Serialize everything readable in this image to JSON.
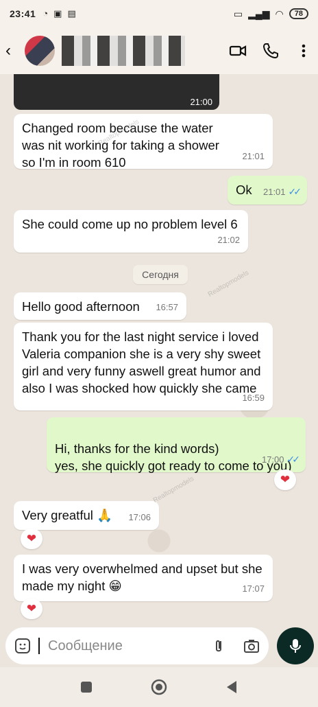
{
  "status_bar": {
    "time": "23:41",
    "battery": "78"
  },
  "header": {
    "back_icon": "back-arrow-icon",
    "video_icon": "video-call-icon",
    "call_icon": "phone-icon",
    "menu_icon": "more-vertical-icon"
  },
  "chat": {
    "media_time": "21:00",
    "messages": [
      {
        "text": "Changed room because the water was nit working for taking a shower so I'm in room 610",
        "time": "21:01"
      },
      {
        "text": "Ok",
        "time": "21:01"
      },
      {
        "text": "She could come up no problem level 6",
        "time": "21:02"
      },
      {
        "text": "Hello good afternoon",
        "time": "16:57"
      },
      {
        "text": "Thank you for the last night service i loved Valeria companion she is a very shy sweet girl and very funny aswell great humor and also I was shocked how quickly she came",
        "time": "16:59"
      },
      {
        "text": "Hi, thanks for the kind words)\nyes, she quickly got ready to come to you)",
        "time": "17:00"
      },
      {
        "text": "Very greatful 🙏",
        "time": "17:06"
      },
      {
        "text": "I was very overwhelmed and upset but she made my night 😁",
        "time": "17:07"
      }
    ],
    "date_separator": "Сегодня",
    "reaction": "❤"
  },
  "composer": {
    "placeholder": "Сообщение"
  },
  "watermark": "Realtopmodels",
  "colors": {
    "incoming": "#ffffff",
    "outgoing": "#e1f8cb",
    "background": "#ece5dd",
    "read_ticks": "#3d8ee6",
    "mic": "#0b2a26"
  }
}
